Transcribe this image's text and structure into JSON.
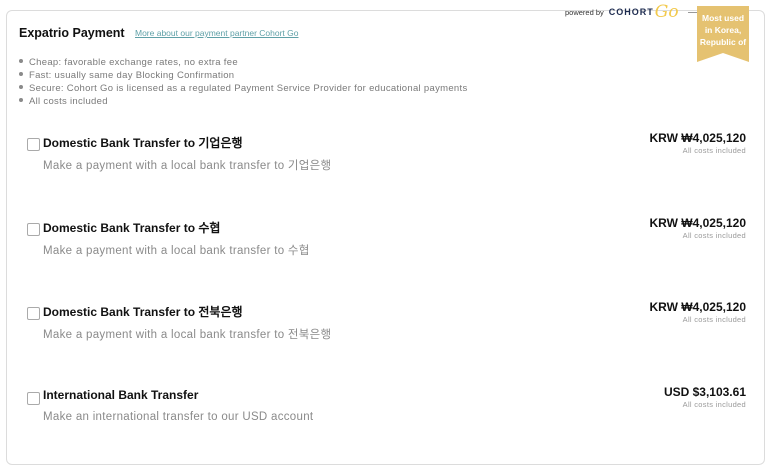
{
  "header": {
    "title": "Expatrio Payment",
    "partner_link": "More about our payment partner Cohort Go",
    "powered_by": "powered by",
    "brand_cohort": "COHORT",
    "brand_go": "Go"
  },
  "ribbon": {
    "line1": "Most used",
    "line2": "in Korea,",
    "line3": "Republic of"
  },
  "features": [
    "Cheap: favorable exchange rates, no extra fee",
    "Fast: usually same day Blocking Confirmation",
    "Secure: Cohort Go is licensed as a regulated Payment Service Provider for educational payments",
    "All costs included"
  ],
  "options": [
    {
      "title": "Domestic Bank Transfer to 기업은행",
      "description": "Make a payment with a local bank transfer to 기업은행",
      "price": "KRW ₩4,025,120",
      "costs_note": "All costs included"
    },
    {
      "title": "Domestic Bank Transfer to 수협",
      "description": "Make a payment with a local bank transfer to 수협",
      "price": "KRW ₩4,025,120",
      "costs_note": "All costs included"
    },
    {
      "title": "Domestic Bank Transfer to 전북은행",
      "description": "Make a payment with a local bank transfer to 전북은행",
      "price": "KRW ₩4,025,120",
      "costs_note": "All costs included"
    },
    {
      "title": "International Bank Transfer",
      "description": "Make an international transfer to our USD account",
      "price": "USD $3,103.61",
      "costs_note": "All costs included"
    }
  ],
  "colors": {
    "accent_link": "#5fa0a7",
    "ribbon": "#e5c271",
    "brand_go": "#f2c94c"
  }
}
